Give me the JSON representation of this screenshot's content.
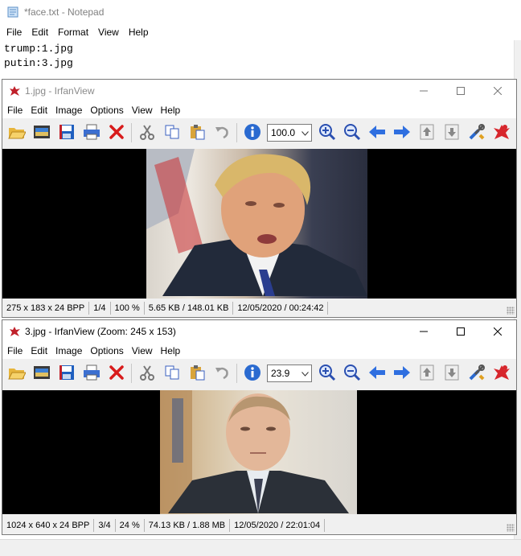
{
  "notepad": {
    "title": "*face.txt - Notepad",
    "menu": [
      "File",
      "Edit",
      "Format",
      "View",
      "Help"
    ],
    "lines": [
      "trump:1.jpg",
      "putin:3.jpg"
    ]
  },
  "viewer1": {
    "title": "1.jpg - IrfanView",
    "menu": [
      "File",
      "Edit",
      "Image",
      "Options",
      "View",
      "Help"
    ],
    "zoom": "100.0",
    "status": [
      "275 x 183 x 24 BPP",
      "1/4",
      "100 %",
      "5.65 KB / 148.01 KB",
      "12/05/2020 / 00:24:42"
    ]
  },
  "viewer2": {
    "title": "3.jpg - IrfanView (Zoom: 245 x 153)",
    "menu": [
      "File",
      "Edit",
      "Image",
      "Options",
      "View",
      "Help"
    ],
    "zoom": "23.9",
    "status": [
      "1024 x 640 x 24 BPP",
      "3/4",
      "24 %",
      "74.13 KB / 1.88 MB",
      "12/05/2020 / 22:01:04"
    ]
  },
  "toolbar_icons": [
    "open-folder-icon",
    "thumbnails-icon",
    "save-icon",
    "print-icon",
    "delete-icon",
    "cut-icon",
    "copy-icon",
    "paste-icon",
    "undo-icon",
    "info-icon",
    "zoom-in-icon",
    "zoom-out-icon",
    "previous-icon",
    "next-icon",
    "first-page-icon",
    "last-page-icon",
    "settings-icon",
    "irfanview-logo-icon"
  ]
}
